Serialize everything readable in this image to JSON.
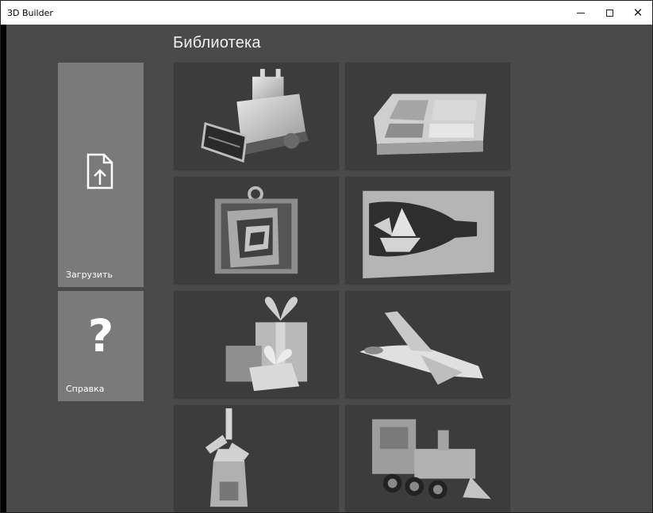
{
  "window": {
    "title": "3D Builder",
    "controls": {
      "minimize_icon": "minimize-icon",
      "maximize_icon": "maximize-icon",
      "close_icon": "close-icon",
      "close_glyph": "✕"
    }
  },
  "library": {
    "title": "Библиотека",
    "models": [
      {
        "name": "bulldozer",
        "icon": "bulldozer-model"
      },
      {
        "name": "tray",
        "icon": "tray-model"
      },
      {
        "name": "frame-pendant",
        "icon": "frame-pendant-model"
      },
      {
        "name": "ship-in-bottle",
        "icon": "ship-in-bottle-model"
      },
      {
        "name": "gift-boxes",
        "icon": "gift-boxes-model"
      },
      {
        "name": "space-shuttle",
        "icon": "space-shuttle-model"
      },
      {
        "name": "windmill",
        "icon": "windmill-model"
      },
      {
        "name": "train",
        "icon": "train-model"
      }
    ]
  },
  "actions": {
    "open": {
      "label": "Загрузить",
      "icon": "file-upload-icon"
    },
    "help": {
      "label": "Справка",
      "icon": "question-icon",
      "glyph": "?"
    }
  },
  "colors": {
    "background": "#4a4a4a",
    "tile": "#7a7a7a",
    "model_tile": "#3c3c3c",
    "titlebar": "#ffffff"
  }
}
